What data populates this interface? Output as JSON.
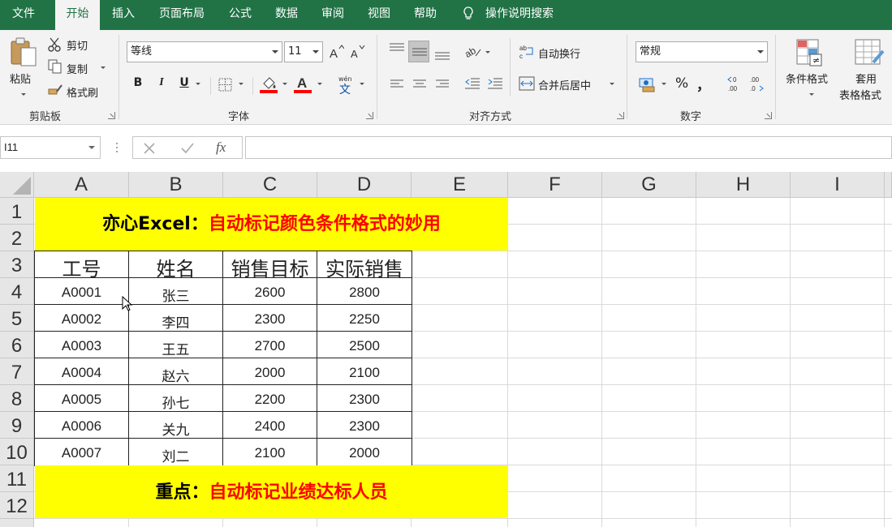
{
  "tabs": [
    {
      "label": "文件"
    },
    {
      "label": "开始"
    },
    {
      "label": "插入"
    },
    {
      "label": "页面布局"
    },
    {
      "label": "公式"
    },
    {
      "label": "数据"
    },
    {
      "label": "审阅"
    },
    {
      "label": "视图"
    },
    {
      "label": "帮助"
    }
  ],
  "tell_me": "操作说明搜索",
  "clipboard": {
    "paste": "粘贴",
    "cut": "剪切",
    "copy": "复制",
    "format_painter": "格式刷",
    "group": "剪贴板"
  },
  "font": {
    "name": "等线",
    "size": "11",
    "bold": "B",
    "italic": "I",
    "underline": "U",
    "group": "字体",
    "fill_color": "#ff0000",
    "font_color": "#ff0000"
  },
  "alignment": {
    "wrap": "自动换行",
    "merge": "合并后居中",
    "group": "对齐方式"
  },
  "number": {
    "format": "常规",
    "percent": "%",
    "comma": "，",
    "group": "数字"
  },
  "styles": {
    "conditional": "条件格式",
    "table_line1": "套用",
    "table_line2": "表格格式"
  },
  "formula_bar": {
    "name_box": "I11",
    "fx": "fx",
    "content": ""
  },
  "columns": [
    "A",
    "B",
    "C",
    "D",
    "E",
    "F",
    "G",
    "H",
    "I"
  ],
  "rows": [
    "1",
    "2",
    "3",
    "4",
    "5",
    "6",
    "7",
    "8",
    "9",
    "10",
    "11",
    "12"
  ],
  "title_banner": {
    "black": "亦心Excel：",
    "red": "自动标记颜色条件格式的妙用"
  },
  "table": {
    "headers": [
      "工号",
      "姓名",
      "销售目标",
      "实际销售"
    ],
    "rows": [
      [
        "A0001",
        "张三",
        "2600",
        "2800"
      ],
      [
        "A0002",
        "李四",
        "2300",
        "2250"
      ],
      [
        "A0003",
        "王五",
        "2700",
        "2500"
      ],
      [
        "A0004",
        "赵六",
        "2000",
        "2100"
      ],
      [
        "A0005",
        "孙七",
        "2200",
        "2300"
      ],
      [
        "A0006",
        "关九",
        "2400",
        "2300"
      ],
      [
        "A0007",
        "刘二",
        "2100",
        "2000"
      ]
    ]
  },
  "bottom_banner": {
    "black": "重点：",
    "red": "自动标记业绩达标人员"
  },
  "colors": {
    "ribbon_green": "#217346",
    "highlight": "#ffff00",
    "accent_red": "#ff0000"
  }
}
